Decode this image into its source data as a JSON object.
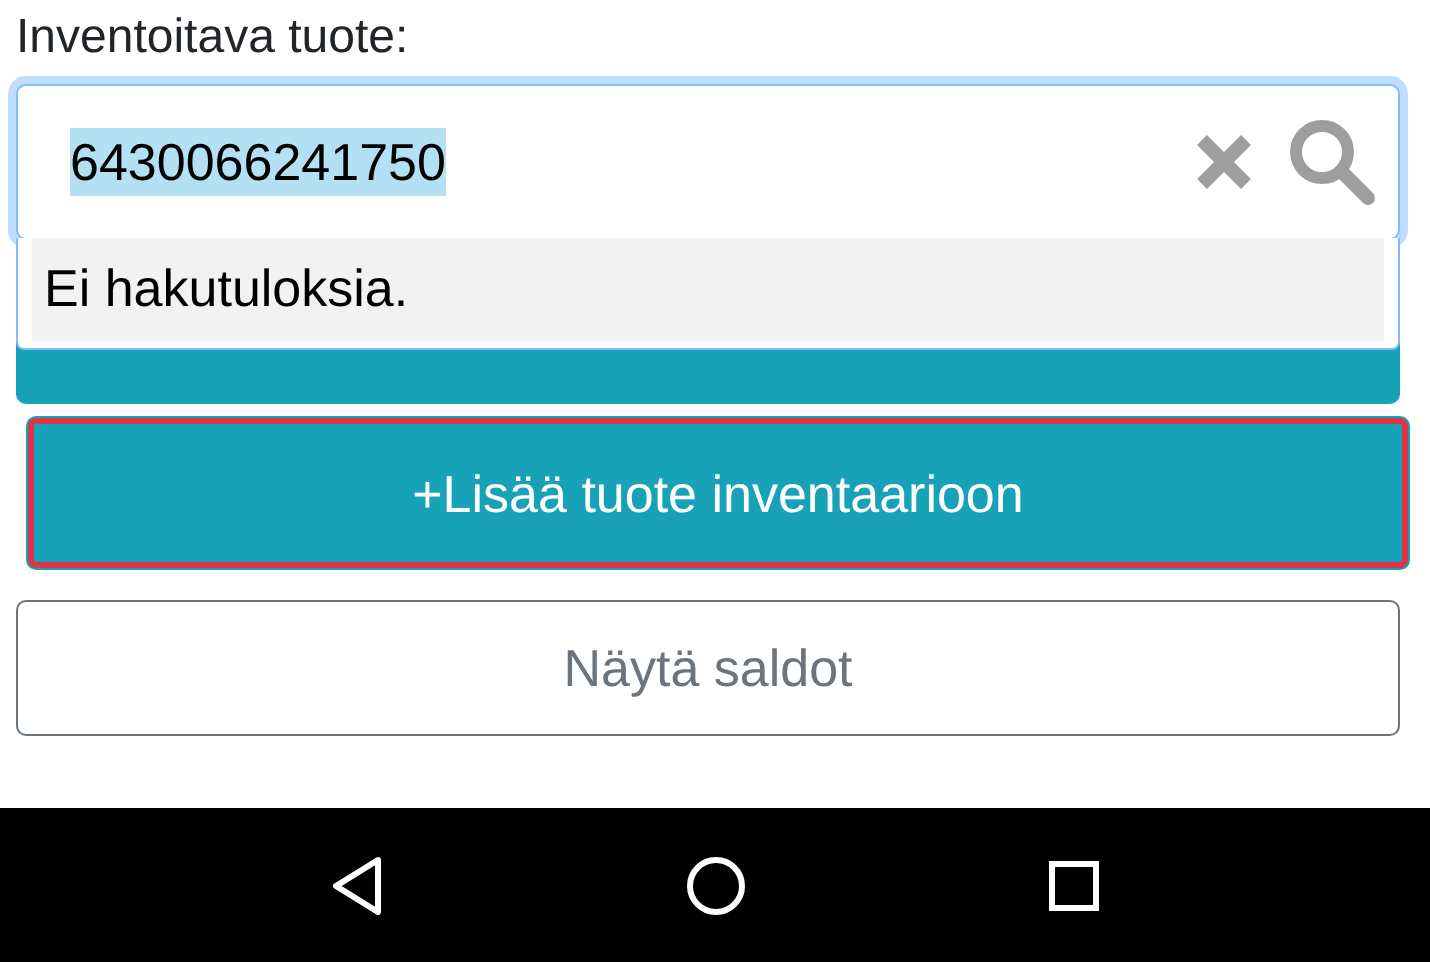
{
  "field_label": "Inventoitava tuote:",
  "search": {
    "value": "6430066241750",
    "text_selected": true
  },
  "suggestions": {
    "message": "Ei hakutuloksia."
  },
  "buttons": [
    {
      "kind": "primary",
      "highlighted": false
    },
    {
      "kind": "primary",
      "label": "+Lisää tuote inventaarioon",
      "highlighted": true
    },
    {
      "kind": "outline",
      "label": "Näytä saldot",
      "highlighted": false
    }
  ]
}
